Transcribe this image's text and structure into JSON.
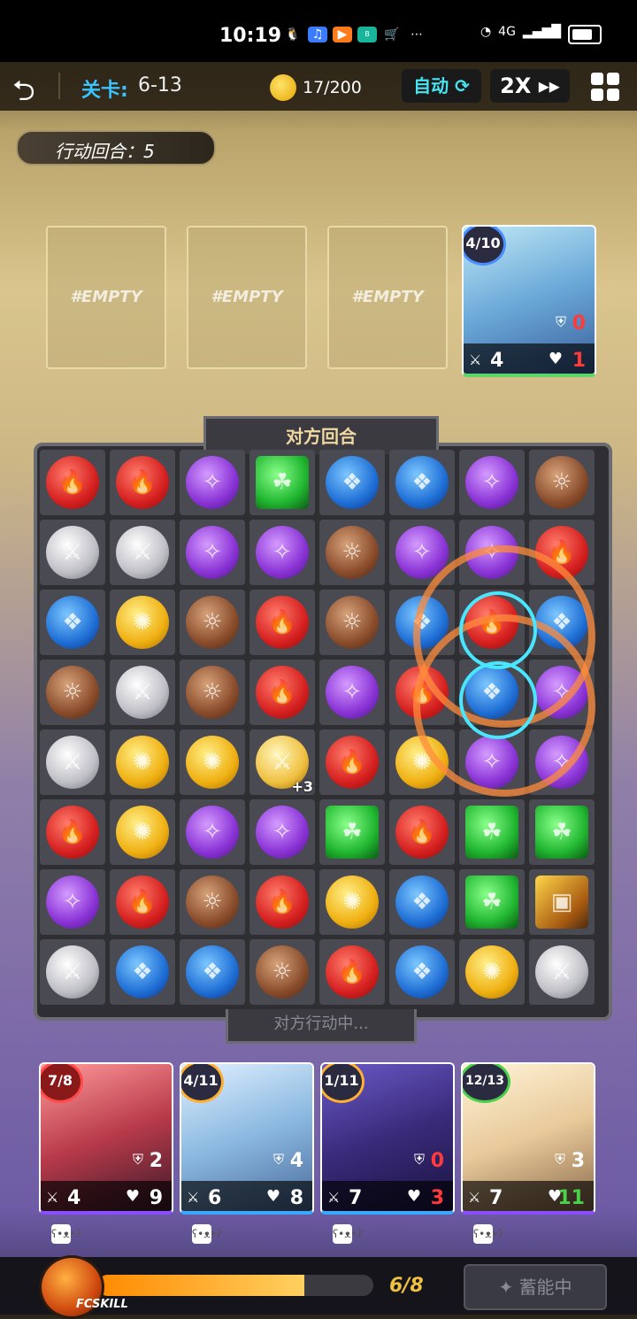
{
  "status_bar": {
    "time": "10:19",
    "network": "4G"
  },
  "header": {
    "level_label": "关卡:",
    "level_value": "6-13",
    "energy": "17/200",
    "auto_label": "自动",
    "speed_label": "2X"
  },
  "turn": {
    "label": "行动回合：5"
  },
  "enemy_slots": [
    {
      "label": "#EMPTY"
    },
    {
      "label": "#EMPTY"
    },
    {
      "label": "#EMPTY"
    }
  ],
  "enemy_card": {
    "cost": "4/10",
    "defense": "0",
    "attack": "4",
    "hp": "1"
  },
  "board": {
    "title": "对方回合",
    "subtitle": "对方行动中...",
    "rows": [
      [
        "red",
        "red",
        "purple",
        "green",
        "blue",
        "blue",
        "purple",
        "brown"
      ],
      [
        "sword",
        "sword",
        "purple",
        "purple",
        "brown",
        "purple",
        "purple",
        "red"
      ],
      [
        "blue",
        "yellow",
        "brown",
        "red",
        "brown",
        "blue",
        "red",
        "blue"
      ],
      [
        "brown",
        "sword",
        "brown",
        "red",
        "purple",
        "red",
        "blue",
        "purple"
      ],
      [
        "sword",
        "yellow",
        "yellow",
        "sword-gold",
        "red",
        "yellow",
        "purple",
        "purple"
      ],
      [
        "red",
        "yellow",
        "purple",
        "purple",
        "green",
        "red",
        "green",
        "green"
      ],
      [
        "purple",
        "red",
        "brown",
        "red",
        "yellow",
        "blue",
        "green",
        "box"
      ],
      [
        "sword",
        "blue",
        "blue",
        "brown",
        "red",
        "blue",
        "yellow",
        "sword"
      ]
    ],
    "bonus_text": "+3"
  },
  "team": [
    {
      "cost": "7/8",
      "defense": "2",
      "attack": "4",
      "hp": "9"
    },
    {
      "cost": "4/11",
      "defense": "4",
      "attack": "6",
      "hp": "8"
    },
    {
      "cost": "1/11",
      "defense": "0",
      "attack": "7",
      "hp": "3"
    },
    {
      "cost": "12/13",
      "defense": "3",
      "attack": "7",
      "hp": "11"
    }
  ],
  "skill": {
    "label": "FCSKILL",
    "count": "6/8",
    "progress": 0.75,
    "charge_label": "蓄能中"
  }
}
